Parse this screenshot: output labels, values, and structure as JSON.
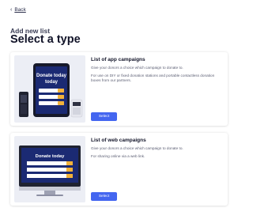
{
  "back": {
    "label": "Back"
  },
  "header": {
    "subtitle": "Add new list",
    "title": "Select a type"
  },
  "cards": [
    {
      "title": "List of app campaigns",
      "paragraphs": [
        "Give your donors a choice which campaign to donate to.",
        "For use on DIY or fixed donation stations and portable contactless donation boxes from our partners."
      ],
      "button": "Select",
      "illustration": {
        "screen_heading": "Donate today"
      }
    },
    {
      "title": "List of web campaigns",
      "paragraphs": [
        "Give your donors a choice which campaign to donate to.",
        "For sharing online via a web link."
      ],
      "button": "Select",
      "illustration": {
        "screen_heading": "Donate today"
      }
    }
  ],
  "colors": {
    "accent": "#4466f0",
    "screen": "#1b2a73",
    "option": "#f2b23a"
  }
}
